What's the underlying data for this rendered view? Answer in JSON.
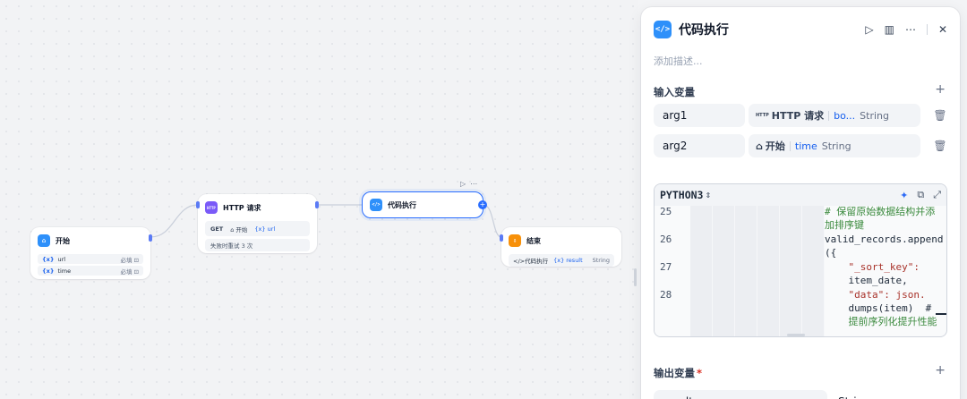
{
  "canvas": {
    "start_node": {
      "title": "开始",
      "vars": [
        {
          "icon": "{x}",
          "name": "url",
          "required": "必填 ⊡"
        },
        {
          "icon": "{x}",
          "name": "time",
          "required": "必填 ⊡"
        }
      ]
    },
    "http_node": {
      "title": "HTTP 请求",
      "icon_text": "HTTP",
      "method": "GET",
      "start_ref": "⌂ 开始",
      "url_ref": "{x} url",
      "retry": "失败时重试 3 次"
    },
    "code_node": {
      "title": "代码执行",
      "icon_text": "</>",
      "tools": [
        "▷",
        "⋯"
      ]
    },
    "end_node": {
      "title": "结束",
      "icon_text": "⇩",
      "output_src": "</>代码执行",
      "output_var": "{x} result",
      "output_type": "String"
    },
    "colors": {
      "start": "#2e90fa",
      "http": "#7a5af8",
      "code": "#2e90fa",
      "end": "#f79009",
      "accent": "#296dff"
    }
  },
  "panel": {
    "title": "代码执行",
    "icon_text": "</>",
    "description_placeholder": "添加描述...",
    "input_section": "输入变量",
    "inputs": [
      {
        "name": "arg1",
        "source_icon": "HTTP",
        "source": "HTTP 请求",
        "ref": "bo...",
        "type": "String"
      },
      {
        "name": "arg2",
        "source_icon": "⌂",
        "source": "开始",
        "ref": "time",
        "type": "String"
      }
    ],
    "editor": {
      "language": "PYTHON3",
      "line_numbers": [
        "25",
        "26",
        "27",
        "28"
      ],
      "lines": [
        "# 保留原始数据结构并添",
        "加排序键",
        "valid_records.append",
        "({",
        "    \"_sort_key\":",
        "    item_date,",
        "    \"data\": json.",
        "    dumps(item)  #",
        "    提前序列化提升性能"
      ]
    },
    "output_section": "输出变量",
    "output_required": "*",
    "outputs": [
      {
        "name": "result",
        "type": "String"
      }
    ]
  }
}
